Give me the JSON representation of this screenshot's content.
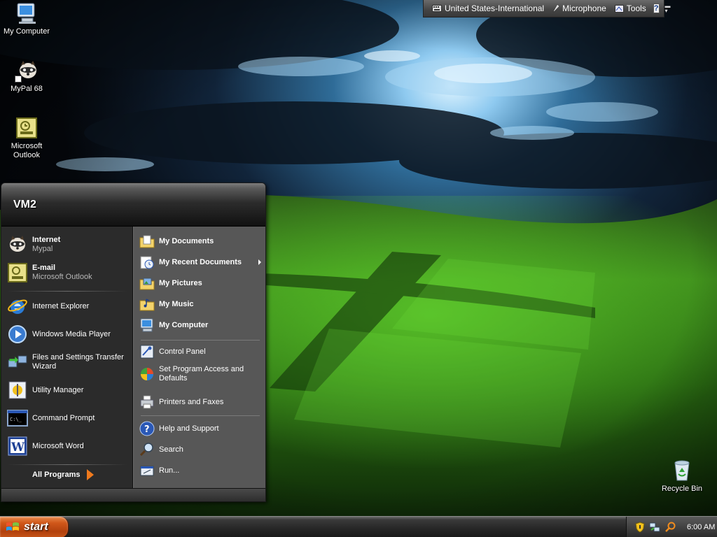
{
  "desktop": {
    "icons": [
      {
        "label": "My Computer",
        "icon": "my-computer-icon"
      },
      {
        "label": "MyPal 68",
        "icon": "raccoon-icon"
      },
      {
        "label": "Microsoft Outlook",
        "icon": "outlook-icon"
      },
      {
        "label": "Recycle Bin",
        "icon": "recycle-bin-icon"
      }
    ]
  },
  "language_bar": {
    "language": "United States-International",
    "microphone": "Microphone",
    "tools": "Tools",
    "help": "?"
  },
  "start_menu": {
    "user_name": "VM2",
    "pinned": [
      {
        "title": "Internet",
        "subtitle": "Mypal",
        "icon": "raccoon-icon"
      },
      {
        "title": "E-mail",
        "subtitle": "Microsoft Outlook",
        "icon": "outlook-icon"
      }
    ],
    "recent": [
      {
        "title": "Internet Explorer",
        "icon": "internet-explorer-icon"
      },
      {
        "title": "Windows Media Player",
        "icon": "media-player-icon"
      },
      {
        "title": "Files and Settings Transfer Wizard",
        "icon": "transfer-wizard-icon"
      },
      {
        "title": "Utility Manager",
        "icon": "utility-manager-icon"
      },
      {
        "title": "Command Prompt",
        "icon": "command-prompt-icon"
      },
      {
        "title": "Microsoft Word",
        "icon": "word-icon"
      }
    ],
    "all_programs": "All Programs",
    "places": [
      {
        "title": "My Documents",
        "icon": "folder-documents-icon"
      },
      {
        "title": "My Recent Documents",
        "icon": "recent-documents-icon"
      },
      {
        "title": "My Pictures",
        "icon": "folder-pictures-icon"
      },
      {
        "title": "My Music",
        "icon": "folder-music-icon"
      },
      {
        "title": "My Computer",
        "icon": "my-computer-icon"
      }
    ],
    "settings": [
      {
        "title": "Control Panel",
        "icon": "control-panel-icon"
      },
      {
        "title": "Set Program Access and Defaults",
        "icon": "program-access-icon"
      },
      {
        "title": "Printers and Faxes",
        "icon": "printer-icon"
      }
    ],
    "help": [
      {
        "title": "Help and Support",
        "icon": "help-icon"
      },
      {
        "title": "Search",
        "icon": "search-icon"
      },
      {
        "title": "Run...",
        "icon": "run-icon"
      }
    ]
  },
  "taskbar": {
    "start_label": "start",
    "clock": "6:00 AM",
    "tray_icons": [
      "security-shield-icon",
      "network-icon",
      "search-tray-icon"
    ]
  },
  "colors": {
    "start_button": "#c9561a",
    "menu_left": "#2b2b2b",
    "menu_right": "#575757",
    "all_programs_arrow": "#f07a1d"
  }
}
